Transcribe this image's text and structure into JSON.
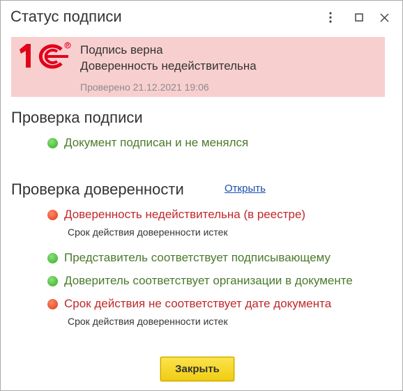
{
  "window": {
    "title": "Статус подписи"
  },
  "banner": {
    "line1": "Подпись верна",
    "line2": "Доверенность недействительна",
    "checked": "Проверено 21.12.2021 19:06",
    "background": "#f8cfcf",
    "logo_color": "#e3001b"
  },
  "signature_section": {
    "title": "Проверка подписи",
    "checks": [
      {
        "status": "ok",
        "text": "Документ подписан и не менялся"
      }
    ]
  },
  "proxy_section": {
    "title": "Проверка доверенности",
    "open_link": "Открыть",
    "checks": [
      {
        "status": "error",
        "text": "Доверенность недействительна (в реестре)",
        "detail": "Срок действия доверенности истек"
      },
      {
        "status": "ok",
        "text": "Представитель соответствует подписывающему"
      },
      {
        "status": "ok",
        "text": "Доверитель соответствует организации в документе"
      },
      {
        "status": "error",
        "text": "Срок действия не соответствует дате документа",
        "detail": "Срок действия доверенности истек"
      }
    ]
  },
  "footer": {
    "close_label": "Закрыть"
  },
  "colors": {
    "ok_text": "#4a7a2c",
    "error_text": "#c0282a",
    "ok_dot": "#5cc44a",
    "error_dot": "#e8502f",
    "link": "#1a4fae",
    "button": "#f5d41e"
  },
  "icons": {
    "more": "more-vertical-icon",
    "maximize": "maximize-icon",
    "close": "close-icon",
    "logo": "1c-logo"
  }
}
